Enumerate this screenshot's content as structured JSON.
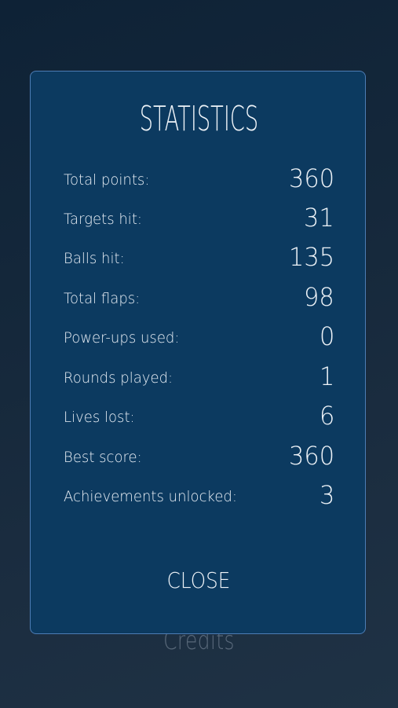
{
  "background": {
    "menu_item_label": "Credits"
  },
  "dialog": {
    "title": "STATISTICS",
    "stats": [
      {
        "label": "Total points:",
        "value": "360"
      },
      {
        "label": "Targets hit:",
        "value": "31"
      },
      {
        "label": "Balls hit:",
        "value": "135"
      },
      {
        "label": "Total flaps:",
        "value": "98"
      },
      {
        "label": "Power-ups used:",
        "value": "0"
      },
      {
        "label": "Rounds played:",
        "value": "1"
      },
      {
        "label": "Lives lost:",
        "value": "6"
      },
      {
        "label": "Best score:",
        "value": "360"
      },
      {
        "label": "Achievements unlocked:",
        "value": "3"
      }
    ],
    "close_label": "CLOSE"
  },
  "colors": {
    "panel_background": "#0c3a60",
    "panel_border": "#4d7db5",
    "text": "#eef3f8",
    "page_background": "#15283b"
  }
}
